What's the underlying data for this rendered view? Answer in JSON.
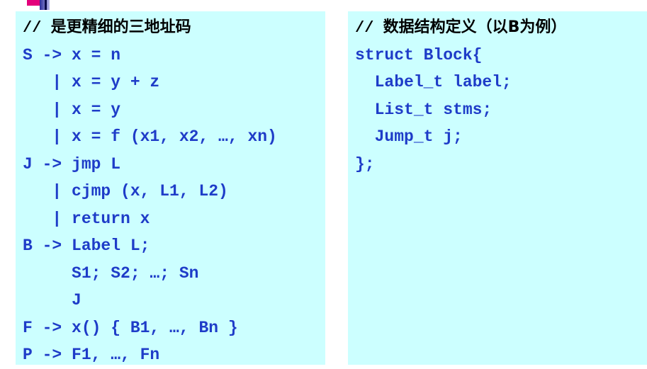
{
  "left_panel": {
    "comment_slashes": "// ",
    "comment_text": "是更精细的三地址码",
    "lines": [
      "S -> x = n",
      "   | x = y + z",
      "   | x = y",
      "   | x = f (x1, x2, …, xn)",
      "J -> jmp L",
      "   | cjmp (x, L1, L2)",
      "   | return x",
      "B -> Label L;",
      "     S1; S2; …; Sn",
      "     J",
      "F -> x() { B1, …, Bn }",
      "P -> F1, …, Fn"
    ]
  },
  "right_panel": {
    "comment_slashes": "// ",
    "comment_text": "数据结构定义（以B为例）",
    "lines": [
      "struct Block{",
      "  Label_t label;",
      "  List_t stms;",
      "  Jump_t j;",
      "};"
    ]
  },
  "colors": {
    "panel_background": "#ccffff",
    "code_text": "#1e3cc8",
    "comment_text": "#000000"
  }
}
